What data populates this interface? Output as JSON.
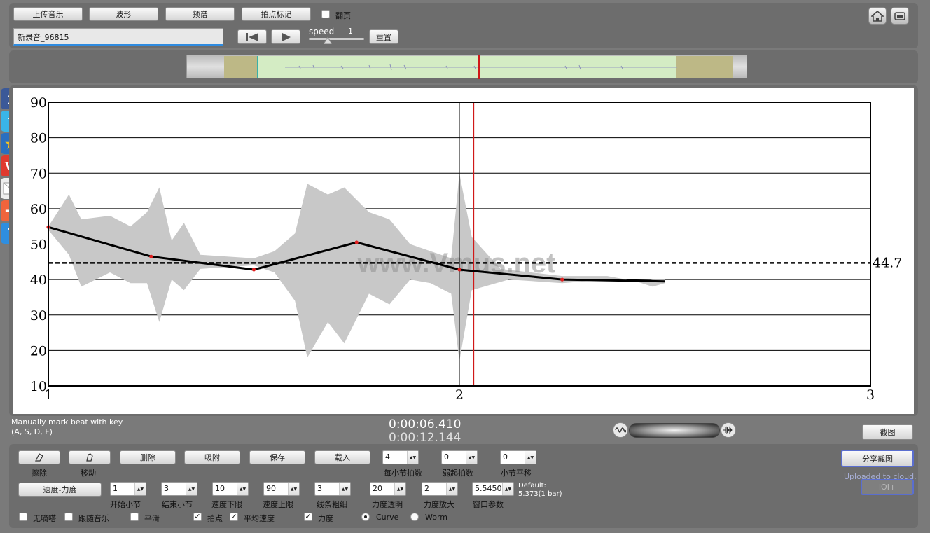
{
  "toolbar": {
    "upload": "上传音乐",
    "waveform": "波形",
    "spectrum": "频谱",
    "beat_mark": "拍点标记",
    "flip_page": "翻页",
    "filename": "新录音_96815",
    "speed_label": "speed",
    "speed_value": "1",
    "reset": "重置"
  },
  "chart_data": {
    "type": "line",
    "ylim": [
      10,
      90
    ],
    "yticks": [
      "90",
      "80",
      "70",
      "60",
      "50",
      "40",
      "30",
      "20",
      "10"
    ],
    "xticks": [
      "1",
      "2",
      "3"
    ],
    "xlim": [
      1,
      3
    ],
    "tempo_series": {
      "x": [
        1.0,
        1.25,
        1.5,
        1.75,
        2.0,
        2.25,
        2.5
      ],
      "y": [
        54.8,
        46.5,
        42.8,
        50.5,
        42.8,
        40.0,
        39.5
      ]
    },
    "band_upper": [
      [
        1.0,
        55
      ],
      [
        1.05,
        64
      ],
      [
        1.08,
        57
      ],
      [
        1.15,
        58
      ],
      [
        1.2,
        55
      ],
      [
        1.24,
        59
      ],
      [
        1.27,
        66
      ],
      [
        1.3,
        51
      ],
      [
        1.33,
        56
      ],
      [
        1.37,
        47
      ],
      [
        1.5,
        46
      ],
      [
        1.55,
        48
      ],
      [
        1.6,
        53
      ],
      [
        1.63,
        67
      ],
      [
        1.68,
        64
      ],
      [
        1.72,
        66
      ],
      [
        1.78,
        59
      ],
      [
        1.83,
        57
      ],
      [
        1.88,
        50
      ],
      [
        1.93,
        48
      ],
      [
        1.98,
        46
      ],
      [
        2.0,
        70
      ],
      [
        2.03,
        52
      ],
      [
        2.1,
        43
      ],
      [
        2.25,
        41
      ],
      [
        2.36,
        41
      ],
      [
        2.43,
        39.5
      ],
      [
        2.47,
        40
      ],
      [
        2.5,
        40
      ]
    ],
    "band_lower": [
      [
        2.5,
        39
      ],
      [
        2.47,
        38
      ],
      [
        2.43,
        39.5
      ],
      [
        2.36,
        40
      ],
      [
        2.25,
        39
      ],
      [
        2.12,
        40
      ],
      [
        2.03,
        37
      ],
      [
        2.0,
        17
      ],
      [
        1.98,
        36
      ],
      [
        1.93,
        39
      ],
      [
        1.88,
        40
      ],
      [
        1.83,
        33
      ],
      [
        1.78,
        36
      ],
      [
        1.72,
        22
      ],
      [
        1.68,
        28
      ],
      [
        1.63,
        18
      ],
      [
        1.6,
        34
      ],
      [
        1.55,
        42
      ],
      [
        1.5,
        44
      ],
      [
        1.37,
        43
      ],
      [
        1.33,
        37
      ],
      [
        1.3,
        40
      ],
      [
        1.27,
        28
      ],
      [
        1.24,
        39
      ],
      [
        1.2,
        39
      ],
      [
        1.15,
        42
      ],
      [
        1.08,
        38
      ],
      [
        1.05,
        47
      ],
      [
        1.0,
        54
      ]
    ],
    "average": 44.7,
    "average_label": "44.7",
    "cursor_x": 2.035,
    "watermark": "www.Vmus.net"
  },
  "status": {
    "hint_line1": "Manually mark beat with key",
    "hint_line2": "(A, S, D, F)",
    "time_current": "0:00:06.410",
    "time_total": "0:00:12.144",
    "screenshot": "截图",
    "share": "分享截图",
    "uploaded": "Uploaded to cloud.",
    "ioi": "IOI+"
  },
  "controls": {
    "erase": "擦除",
    "move": "移动",
    "delete": "删除",
    "snap": "吸附",
    "save": "保存",
    "load": "载入",
    "mode": "速度-力度",
    "beats_per_bar": {
      "value": "4",
      "label": "每小节拍数"
    },
    "pickup": {
      "value": "0",
      "label": "弱起拍数"
    },
    "bar_shift": {
      "value": "0",
      "label": "小节平移"
    },
    "start_bar": {
      "value": "1",
      "label": "开始小节"
    },
    "end_bar": {
      "value": "3",
      "label": "结束小节"
    },
    "tempo_min": {
      "value": "10",
      "label": "速度下限"
    },
    "tempo_max": {
      "value": "90",
      "label": "速度上限"
    },
    "line_width": {
      "value": "3",
      "label": "线条粗细"
    },
    "dyn_alpha": {
      "value": "20",
      "label": "力度透明"
    },
    "dyn_scale": {
      "value": "2",
      "label": "力度放大"
    },
    "window": {
      "value": "5.5450",
      "label": "窗口参数"
    },
    "default_line1": "Default:",
    "default_line2": "5.373(1 bar)",
    "opt_no_click": "无嘀嗒",
    "opt_follow": "跟随音乐",
    "opt_smooth": "平滑",
    "opt_beat": "拍点",
    "opt_avg": "平均速度",
    "opt_dynamics": "力度",
    "opt_curve": "Curve",
    "opt_worm": "Worm",
    "check_mark": "✓"
  },
  "colors": {
    "tempo_line": "#000000",
    "beat_dot": "#e02020",
    "band": "#c8c8c8",
    "cursor": "#d01818"
  }
}
